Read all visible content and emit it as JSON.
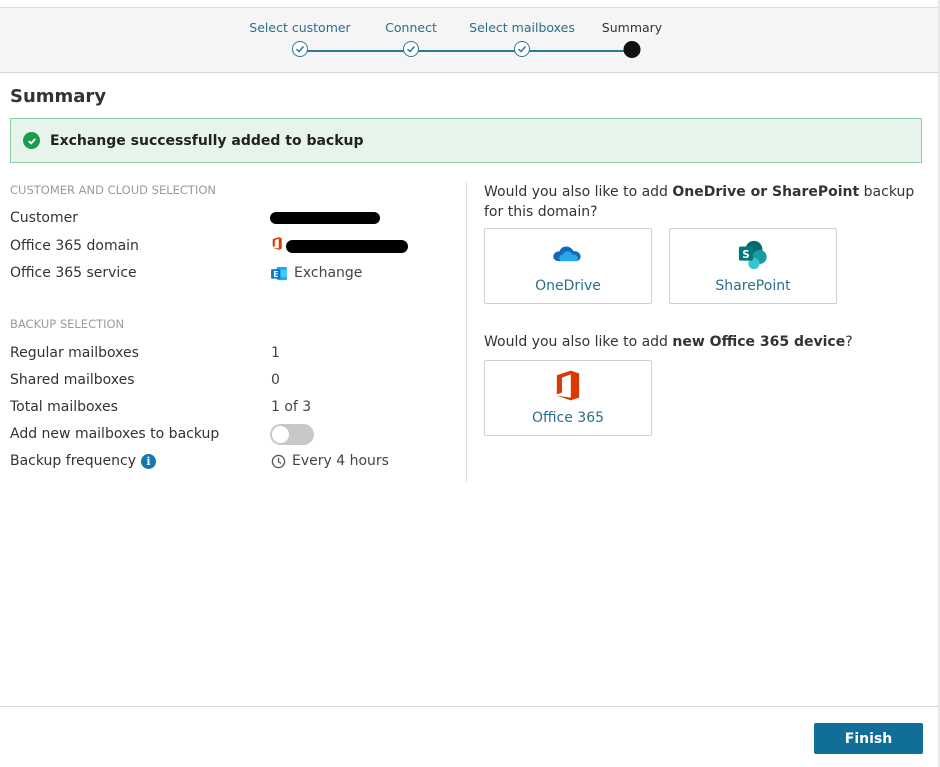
{
  "stepper": {
    "steps": [
      {
        "label": "Select customer",
        "state": "done"
      },
      {
        "label": "Connect",
        "state": "done"
      },
      {
        "label": "Select mailboxes",
        "state": "done"
      },
      {
        "label": "Summary",
        "state": "current"
      }
    ]
  },
  "page_title": "Summary",
  "banner": {
    "message": "Exchange successfully added to backup",
    "icon": "check-circle-icon"
  },
  "customer_section": {
    "heading": "CUSTOMER AND CLOUD SELECTION",
    "rows": [
      {
        "label": "Customer",
        "value": ""
      },
      {
        "label": "Office 365 domain",
        "value": "",
        "icon": "office365-icon"
      },
      {
        "label": "Office 365 service",
        "value": "Exchange",
        "icon": "exchange-icon"
      }
    ]
  },
  "backup_section": {
    "heading": "BACKUP SELECTION",
    "regular_mailboxes": {
      "label": "Regular mailboxes",
      "value": "1"
    },
    "shared_mailboxes": {
      "label": "Shared mailboxes",
      "value": "0"
    },
    "total_mailboxes": {
      "label": "Total mailboxes",
      "value": "1 of 3"
    },
    "add_new": {
      "label": "Add new mailboxes to backup",
      "toggle_on": false
    },
    "frequency": {
      "label": "Backup frequency",
      "value": "Every 4 hours",
      "icon": "clock-icon"
    }
  },
  "right_panel": {
    "question1": {
      "prefix": "Would you also like to add ",
      "bold": "OneDrive or SharePoint",
      "suffix": " backup for this domain?"
    },
    "cards1": [
      {
        "label": "OneDrive",
        "icon": "onedrive-icon"
      },
      {
        "label": "SharePoint",
        "icon": "sharepoint-icon"
      }
    ],
    "question2": {
      "prefix": "Would you also like to add ",
      "bold": "new Office 365 device",
      "suffix": "?"
    },
    "cards2": [
      {
        "label": "Office 365",
        "icon": "office365-icon"
      }
    ]
  },
  "footer": {
    "finish_label": "Finish"
  },
  "colors": {
    "accent": "#106e98",
    "success": "#1e9c4e",
    "banner_bg": "#e6f4ec",
    "step_line": "#2b7a96"
  }
}
